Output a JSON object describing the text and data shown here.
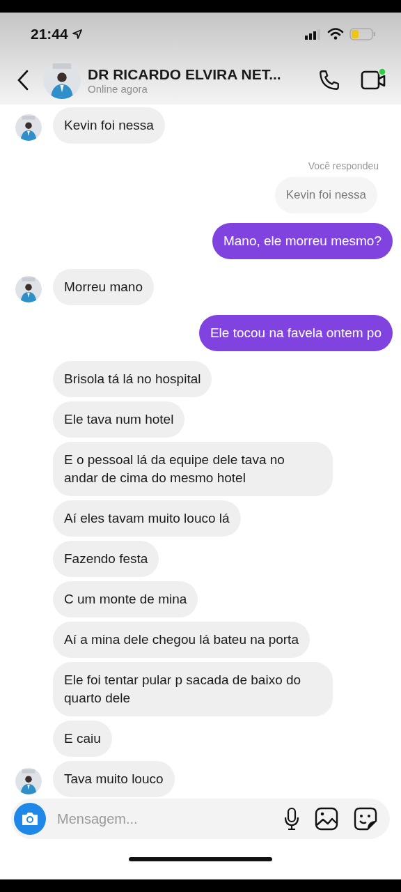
{
  "status_bar": {
    "time": "21:44"
  },
  "header": {
    "name": "DR RICARDO ELVIRA NET...",
    "status": "Online agora"
  },
  "messages": [
    {
      "kind": "received",
      "text": "Kevin foi nessa",
      "avatar": true
    },
    {
      "kind": "note",
      "text": "Você respondeu"
    },
    {
      "kind": "quoted",
      "text": "Kevin foi nessa"
    },
    {
      "kind": "sent",
      "text": "Mano, ele morreu mesmo?"
    },
    {
      "kind": "received",
      "text": "Morreu mano",
      "avatar": true
    },
    {
      "kind": "sent",
      "text": "Ele tocou na favela ontem po"
    },
    {
      "kind": "received",
      "text": "Brisola tá lá no hospital",
      "avatar": false
    },
    {
      "kind": "received",
      "text": "Ele tava num hotel",
      "avatar": false
    },
    {
      "kind": "received",
      "text": "E o pessoal lá da equipe dele tava no andar de cima do mesmo hotel",
      "avatar": false
    },
    {
      "kind": "received",
      "text": "Aí eles tavam muito louco lá",
      "avatar": false
    },
    {
      "kind": "received",
      "text": "Fazendo festa",
      "avatar": false
    },
    {
      "kind": "received",
      "text": "C um monte de mina",
      "avatar": false
    },
    {
      "kind": "received",
      "text": "Aí a mina dele chegou lá bateu na porta",
      "avatar": false
    },
    {
      "kind": "received",
      "text": "Ele foi tentar pular p sacada de baixo do quarto dele",
      "avatar": false
    },
    {
      "kind": "received",
      "text": "E caiu",
      "avatar": false
    },
    {
      "kind": "received",
      "text": "Tava muito louco",
      "avatar": true
    }
  ],
  "composer": {
    "placeholder": "Mensagem..."
  }
}
